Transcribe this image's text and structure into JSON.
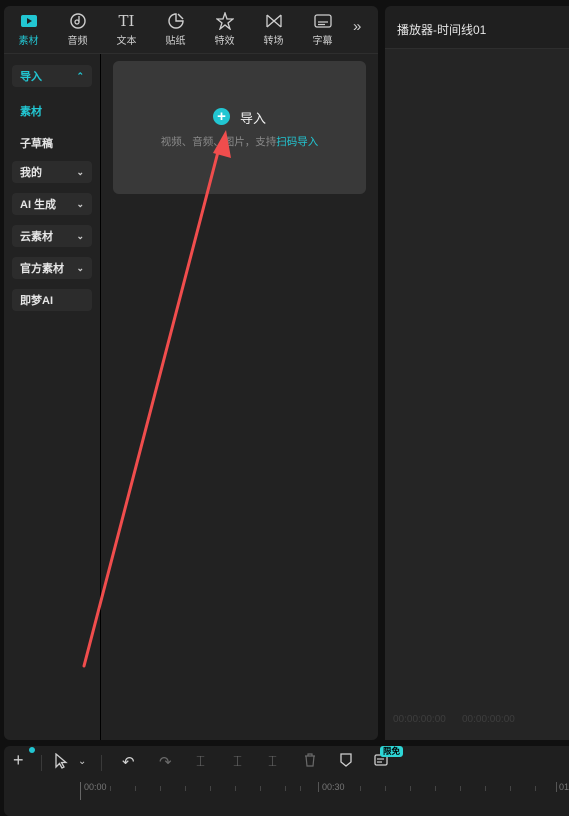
{
  "tabs": [
    {
      "label": "素材",
      "icon": "media-icon",
      "active": true
    },
    {
      "label": "音频",
      "icon": "audio-icon"
    },
    {
      "label": "文本",
      "icon": "text-icon"
    },
    {
      "label": "贴纸",
      "icon": "sticker-icon"
    },
    {
      "label": "特效",
      "icon": "effects-icon"
    },
    {
      "label": "转场",
      "icon": "transition-icon"
    },
    {
      "label": "字幕",
      "icon": "caption-icon"
    }
  ],
  "more_label": "»",
  "sidebar": {
    "import": "导入",
    "material": "素材",
    "sub_draft": "子草稿",
    "mine": "我的",
    "ai_gen": "AI 生成",
    "cloud": "云素材",
    "official": "官方素材",
    "jimeng": "即梦AI"
  },
  "import_card": {
    "label": "导入",
    "hint": "视频、音频、图片，支持",
    "link": "扫码导入"
  },
  "player": {
    "title": "播放器-时间线01",
    "timecode_current": "00:00:00:00",
    "timecode_total": "00:00:00:00"
  },
  "bottom": {
    "badge": "限免",
    "ruler": [
      "00:00",
      "00:30",
      "01"
    ]
  },
  "colors": {
    "accent": "#22c6d2",
    "annotation": "#f04d4d"
  }
}
